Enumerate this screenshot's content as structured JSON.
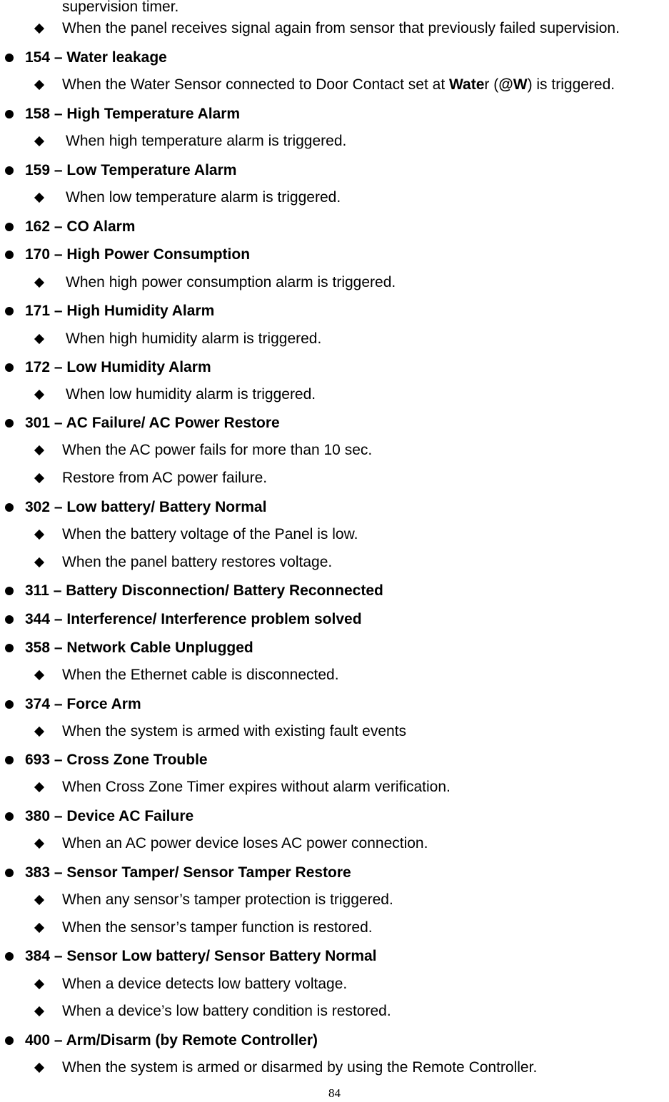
{
  "continuation": "supervision timer.",
  "items": [
    {
      "type": "sub",
      "text": "When the panel receives signal again from sensor that previously failed supervision."
    },
    {
      "type": "heading",
      "text": "154 – Water leakage"
    },
    {
      "type": "sub-rich",
      "parts": [
        "When the Water Sensor connected to Door Contact set at ",
        "Wate",
        "r (",
        "@W",
        ") is triggered."
      ]
    },
    {
      "type": "heading",
      "text": "158 – High Temperature Alarm"
    },
    {
      "type": "sub",
      "text": "When high temperature alarm is triggered."
    },
    {
      "type": "heading",
      "text": "159 – Low Temperature Alarm"
    },
    {
      "type": "sub",
      "text": "When low temperature alarm is triggered."
    },
    {
      "type": "heading",
      "text": "162 – CO Alarm"
    },
    {
      "type": "heading",
      "text": "170 – High Power Consumption"
    },
    {
      "type": "sub",
      "text": "When high power consumption alarm is triggered."
    },
    {
      "type": "heading",
      "text": "171 – High Humidity Alarm"
    },
    {
      "type": "sub",
      "text": "When high humidity alarm is triggered."
    },
    {
      "type": "heading",
      "text": "172 – Low Humidity Alarm"
    },
    {
      "type": "sub",
      "text": "When low humidity alarm is triggered."
    },
    {
      "type": "heading",
      "text": "301 – AC Failure/ AC Power Restore"
    },
    {
      "type": "sub",
      "text": "When the AC power fails for more than 10 sec."
    },
    {
      "type": "sub",
      "text": "Restore from AC power failure."
    },
    {
      "type": "heading",
      "text": "302 – Low battery/ Battery Normal"
    },
    {
      "type": "sub",
      "text": "When the battery voltage of the Panel is low."
    },
    {
      "type": "sub",
      "text": "When the panel battery restores voltage."
    },
    {
      "type": "heading",
      "text": "311 – Battery Disconnection/ Battery Reconnected"
    },
    {
      "type": "heading",
      "text": "344 – Interference/ Interference problem solved"
    },
    {
      "type": "heading",
      "text": "358 – Network Cable Unplugged"
    },
    {
      "type": "sub",
      "text": "When the Ethernet cable is disconnected."
    },
    {
      "type": "heading",
      "text": "374 – Force Arm"
    },
    {
      "type": "sub",
      "text": "When the system is armed with existing fault events"
    },
    {
      "type": "heading",
      "text": "693 – Cross Zone Trouble"
    },
    {
      "type": "sub",
      "text": "When Cross Zone Timer expires without alarm verification."
    },
    {
      "type": "heading",
      "text": "380 – Device AC Failure"
    },
    {
      "type": "sub",
      "text": "When an AC power device loses AC power connection."
    },
    {
      "type": "heading",
      "text": "383 – Sensor Tamper/ Sensor Tamper Restore"
    },
    {
      "type": "sub",
      "text": "When any sensor’s tamper protection is triggered."
    },
    {
      "type": "sub",
      "text": "When the sensor’s tamper function is restored."
    },
    {
      "type": "heading",
      "text": "384 – Sensor Low battery/ Sensor Battery Normal"
    },
    {
      "type": "sub",
      "text": "When a device detects low battery voltage."
    },
    {
      "type": "sub",
      "text": "When a device’s low battery condition is restored."
    },
    {
      "type": "heading",
      "text": "400 – Arm/Disarm (by Remote Controller)"
    },
    {
      "type": "sub",
      "text": "When the system is armed or disarmed by using the Remote Controller."
    }
  ],
  "page_number": "84"
}
